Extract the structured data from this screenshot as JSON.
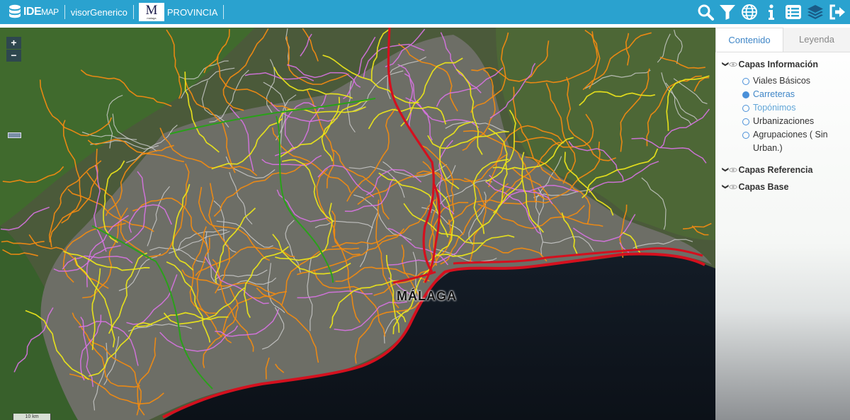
{
  "header": {
    "logo_main": "IDE",
    "logo_sub": "MAP",
    "viewer_name": "visorGenerico",
    "brand_letter": "M",
    "brand_caption": "malaga",
    "province": "PROVINCIA"
  },
  "toolbar": {
    "icons": [
      "search-icon",
      "filter-icon",
      "globe-icon",
      "info-icon",
      "list-icon",
      "layers-icon",
      "logout-icon"
    ]
  },
  "map": {
    "city_label": "MÁLAGA",
    "scale_label": "10 km",
    "zoom_in": "+",
    "zoom_out": "−",
    "road_colors": {
      "motorway": "#d4101e",
      "primary": "#f08a12",
      "secondary": "#e9e31b",
      "tertiary": "#d873e3",
      "local": "#d0d0d0",
      "green_route": "#2aa11a"
    }
  },
  "panel": {
    "tabs": [
      "Contenido",
      "Leyenda"
    ],
    "sections": {
      "info": "Capas Información",
      "reference": "Capas Referencia",
      "base": "Capas Base"
    },
    "layers": [
      {
        "label": "Viales Básicos",
        "selected": false
      },
      {
        "label": "Carreteras",
        "selected": true
      },
      {
        "label": "Topónimos",
        "selected": false
      },
      {
        "label": "Urbanizaciones",
        "selected": false
      },
      {
        "label": "Agrupaciones ( Sin Urban.)",
        "selected": false
      }
    ],
    "accent_color": "#3f86c7"
  }
}
